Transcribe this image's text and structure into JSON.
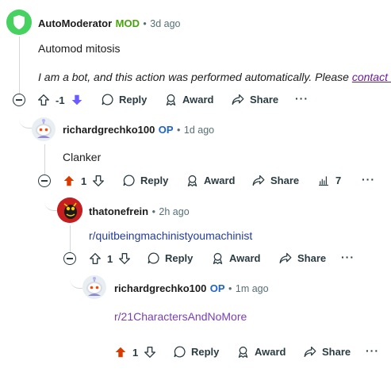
{
  "comments": [
    {
      "author": "AutoModerator",
      "badge": "MOD",
      "time": "3d ago",
      "body_line1": "Automod mitosis",
      "body_line2": "I am a bot, and this action was performed automatically. Please",
      "body_link": "contact th",
      "votes": "-1",
      "reply": "Reply",
      "award": "Award",
      "share": "Share"
    },
    {
      "author": "richardgrechko100",
      "badge": "OP",
      "time": "1d ago",
      "body": "Clanker",
      "votes": "1",
      "reply": "Reply",
      "award": "Award",
      "share": "Share",
      "insights": "7"
    },
    {
      "author": "thatonefrein",
      "time": "2h ago",
      "body": "r/quitbeingmachinistyoumachinist",
      "votes": "1",
      "reply": "Reply",
      "award": "Award",
      "share": "Share"
    },
    {
      "author": "richardgrechko100",
      "badge": "OP",
      "time": "1m ago",
      "body": "r/21CharactersAndNoMore",
      "votes": "1",
      "reply": "Reply",
      "award": "Award",
      "share": "Share"
    }
  ],
  "separator": "•",
  "colors": {
    "mod_green": "#46a508",
    "op_blue": "#1f62c9",
    "upvote_orange": "#d93a00",
    "downvote_purple": "#6a5cff",
    "link_purple": "#7a3fb3",
    "thread_line": "#d4d7d9"
  }
}
